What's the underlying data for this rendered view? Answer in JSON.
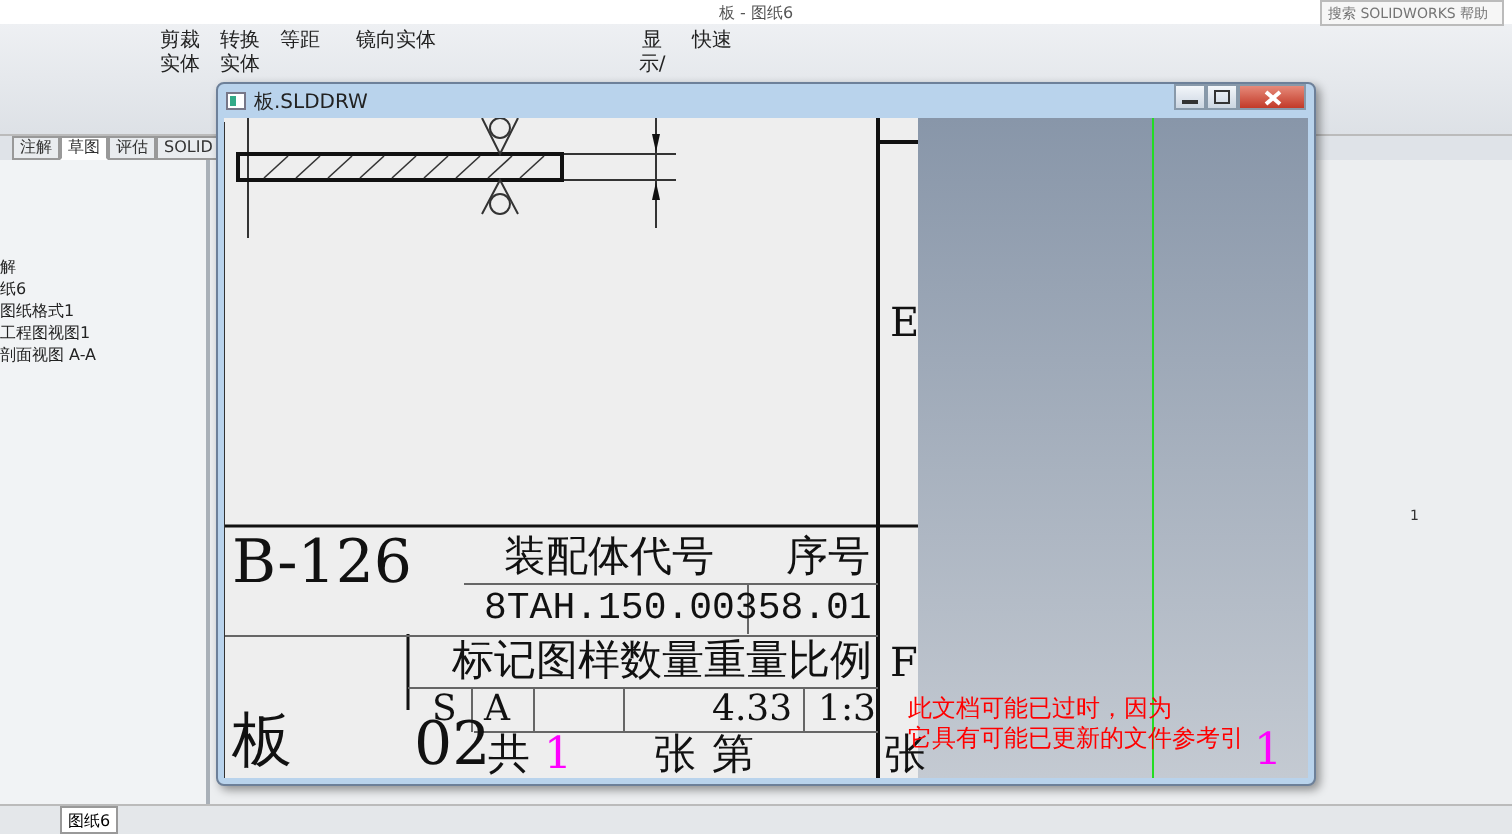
{
  "app_title": "板 - 图纸6",
  "search": {
    "placeholder": "搜索 SOLIDWORKS 帮助"
  },
  "ribbon": [
    {
      "label": "剪裁实体"
    },
    {
      "label": "转换实体"
    },
    {
      "label": "等距"
    },
    {
      "label": "镜向实体"
    },
    {
      "label": "显示/"
    },
    {
      "label": "快速"
    }
  ],
  "tabs": [
    {
      "label": "注解",
      "selected": false
    },
    {
      "label": "草图",
      "selected": true
    },
    {
      "label": "评估",
      "selected": false
    },
    {
      "label": "SOLID",
      "selected": false
    }
  ],
  "tree": {
    "children": [
      {
        "label": "解"
      },
      {
        "label": "纸6",
        "children": [
          {
            "label": "图纸格式1"
          },
          {
            "label": "工程图视图1",
            "children": [
              {
                "label": "剖面视图 A-A"
              }
            ]
          }
        ]
      }
    ]
  },
  "sheet_tab": "图纸6",
  "side_number": "1",
  "document": {
    "title": "板.SLDDRW",
    "labels": [
      {
        "text": "E",
        "kind": "zone"
      },
      {
        "text": "B-126",
        "kind": "large"
      },
      {
        "text": "装配体代号",
        "kind": "cell"
      },
      {
        "text": "序号",
        "kind": "cell"
      },
      {
        "text": "8TAH.150.00358.01",
        "kind": "code"
      },
      {
        "text": "标记图样数量重量比例",
        "kind": "cell"
      },
      {
        "text": "S",
        "kind": "small"
      },
      {
        "text": "A",
        "kind": "small"
      },
      {
        "text": "4.33",
        "kind": "small"
      },
      {
        "text": "1:3",
        "kind": "small"
      },
      {
        "text": "F",
        "kind": "zone"
      },
      {
        "text": "板",
        "kind": "large"
      },
      {
        "text": "02",
        "kind": "large"
      },
      {
        "text": "共",
        "kind": "cell"
      },
      {
        "text": "1",
        "kind": "highlight"
      },
      {
        "text": "张",
        "kind": "cell"
      },
      {
        "text": "第",
        "kind": "cell"
      },
      {
        "text": "张",
        "kind": "cell"
      },
      {
        "text": "1",
        "kind": "highlight"
      }
    ],
    "warning": [
      "此文档可能已过时，因为",
      "它具有可能已更新的文件参考引"
    ]
  }
}
